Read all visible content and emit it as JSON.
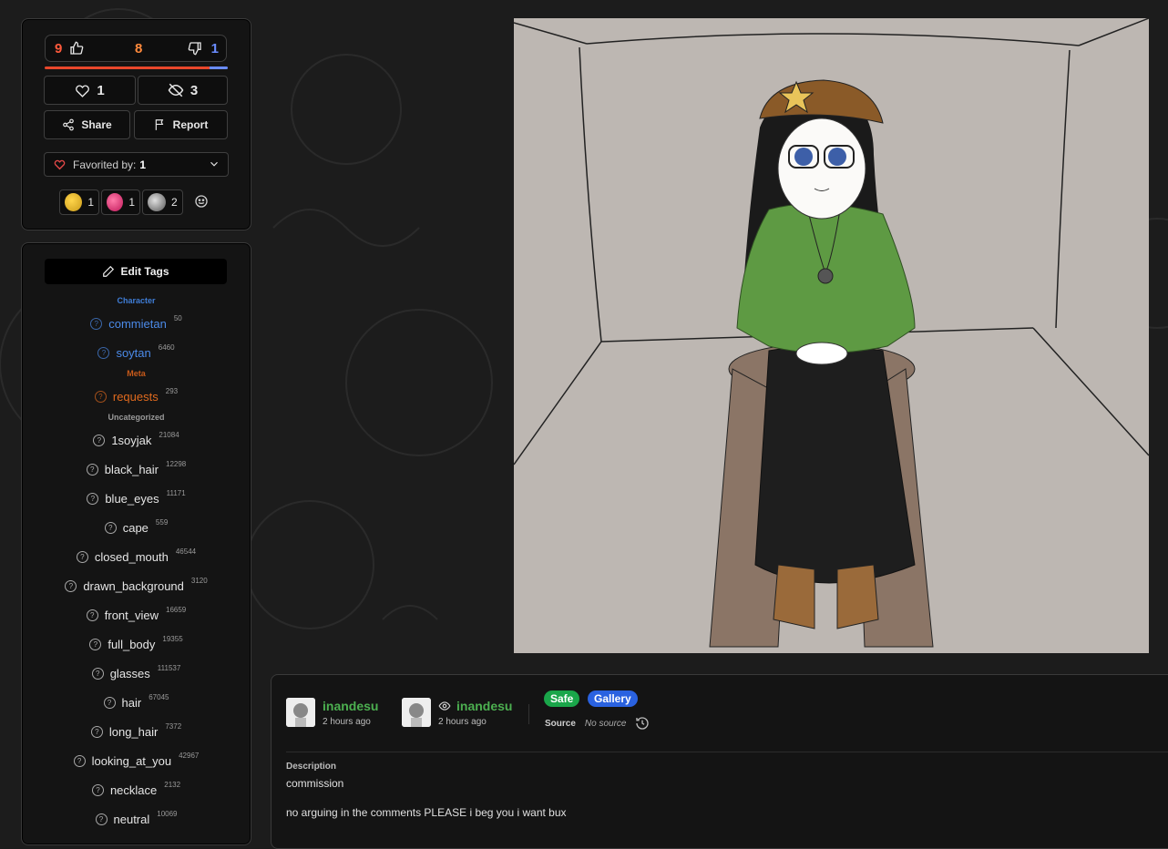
{
  "votes": {
    "upvotes": "9",
    "score": "8",
    "downvotes": "1",
    "favorites": "1",
    "hidden": "3",
    "share_label": "Share",
    "report_label": "Report",
    "favorited_by_label": "Favorited by:",
    "favorited_by_count": "1"
  },
  "reactions": [
    {
      "count": "1"
    },
    {
      "count": "1"
    },
    {
      "count": "2"
    }
  ],
  "tags": {
    "edit_label": "Edit Tags",
    "categories": [
      {
        "name": "Character",
        "color": "#3f7dd6",
        "items": [
          {
            "name": "commietan",
            "count": "50"
          },
          {
            "name": "soytan",
            "count": "6460"
          }
        ]
      },
      {
        "name": "Meta",
        "color": "#c85a1a",
        "items": [
          {
            "name": "requests",
            "count": "293"
          }
        ]
      },
      {
        "name": "Uncategorized",
        "color": "#9a9a9a",
        "items": [
          {
            "name": "1soyjak",
            "count": "21084"
          },
          {
            "name": "black_hair",
            "count": "12298"
          },
          {
            "name": "blue_eyes",
            "count": "11171"
          },
          {
            "name": "cape",
            "count": "559"
          },
          {
            "name": "closed_mouth",
            "count": "46544"
          },
          {
            "name": "drawn_background",
            "count": "3120"
          },
          {
            "name": "front_view",
            "count": "16659"
          },
          {
            "name": "full_body",
            "count": "19355"
          },
          {
            "name": "glasses",
            "count": "111537"
          },
          {
            "name": "hair",
            "count": "67045"
          },
          {
            "name": "long_hair",
            "count": "7372"
          },
          {
            "name": "looking_at_you",
            "count": "42967"
          },
          {
            "name": "necklace",
            "count": "2132"
          },
          {
            "name": "neutral",
            "count": "10069"
          }
        ]
      }
    ]
  },
  "post": {
    "uploader": {
      "name": "inandesu",
      "time": "2 hours ago"
    },
    "approver": {
      "name": "inandesu",
      "time": "2 hours ago"
    },
    "rating_badge": "Safe",
    "type_badge": "Gallery",
    "source_label": "Source",
    "source_value": "No source",
    "description_label": "Description",
    "description_lines": [
      "commission",
      "no arguing in the comments PLEASE i beg you i want bux"
    ]
  },
  "colors": {
    "upvote": "#ff5a3c",
    "downvote": "#6a8cff",
    "username": "#4caf50",
    "safe_badge": "#1aa64a",
    "gallery_badge": "#2a62e0"
  }
}
